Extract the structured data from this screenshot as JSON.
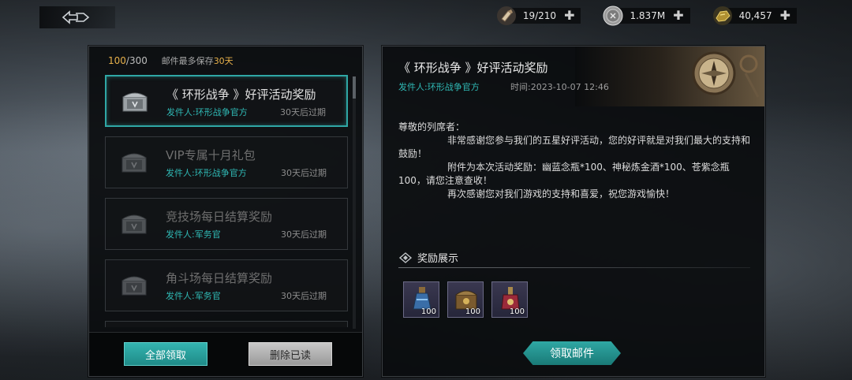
{
  "resources": [
    {
      "icon": "scroll-icon",
      "value": "19/210"
    },
    {
      "icon": "silver-coin-icon",
      "value": "1.837M"
    },
    {
      "icon": "gold-ore-icon",
      "value": "40,457"
    }
  ],
  "inbox": {
    "count_current": "100",
    "count_sep_max": "/300",
    "note_prefix": "邮件最多保存",
    "note_days": "30天"
  },
  "mails": [
    {
      "title": "《 环形战争 》好评活动奖励",
      "sender": "发件人:环形战争官方",
      "expires": "30天后过期",
      "state": "active"
    },
    {
      "title": "VIP专属十月礼包",
      "sender": "发件人:环形战争官方",
      "expires": "30天后过期",
      "state": "read"
    },
    {
      "title": "竞技场每日结算奖励",
      "sender": "发件人:军务官",
      "expires": "30天后过期",
      "state": "read"
    },
    {
      "title": "角斗场每日结算奖励",
      "sender": "发件人:军务官",
      "expires": "30天后过期",
      "state": "read"
    }
  ],
  "buttons": {
    "claim_all": "全部领取",
    "delete_read": "删除已读",
    "claim_mail": "领取邮件"
  },
  "detail": {
    "title": "《 环形战争 》好评活动奖励",
    "sender": "发件人:环形战争官方",
    "time": "时间:2023-10-07 12:46",
    "greeting": "尊敬的列席者：",
    "para1": "非常感谢您参与我们的五星好评活动，您的好评就是对我们最大的支持和鼓励！",
    "para2": "附件为本次活动奖励：幽蓝念瓶*100、神秘炼金酒*100、苍紫念瓶100，请您注意查收！",
    "para3": "再次感谢您对我们游戏的支持和喜爱，祝您游戏愉快！",
    "reward_heading": "奖励展示"
  },
  "rewards": [
    {
      "icon": "blue-flask-icon",
      "qty": "100"
    },
    {
      "icon": "alchemy-chest-icon",
      "qty": "100"
    },
    {
      "icon": "purple-flask-icon",
      "qty": "100"
    }
  ],
  "colors": {
    "accent_teal": "#2fa7a5",
    "highlight_gold": "#e7b04a"
  }
}
